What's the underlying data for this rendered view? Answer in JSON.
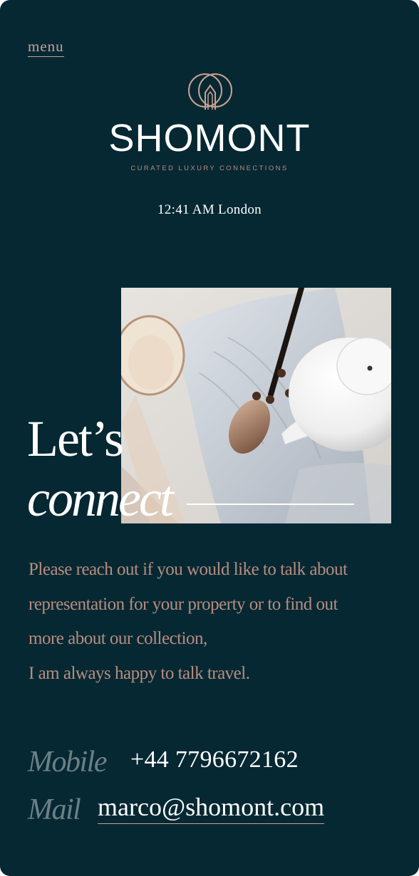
{
  "header": {
    "menu_label": "menu",
    "brand_name": "SHOMONT",
    "tagline": "CURATED LUXURY CONNECTIONS",
    "clock": "12:41 AM London"
  },
  "hero": {
    "heading_line1": "Let’s",
    "heading_line2": "connect",
    "photo_icon": "photo-teapot-spoon-icon"
  },
  "intro": {
    "lines": [
      "Please reach out if you would like to talk about",
      "representation for your property or to find out",
      "more about our collection,",
      "I am always happy to talk travel."
    ]
  },
  "contact": {
    "mobile_label": "Mobile",
    "mobile_value": "+44 7796672162",
    "mail_label": "Mail",
    "mail_value": "marco@shomont.com"
  },
  "colors": {
    "background": "#062833",
    "accent": "#c9a192",
    "text": "#ffffff",
    "muted": "#6b8086"
  }
}
